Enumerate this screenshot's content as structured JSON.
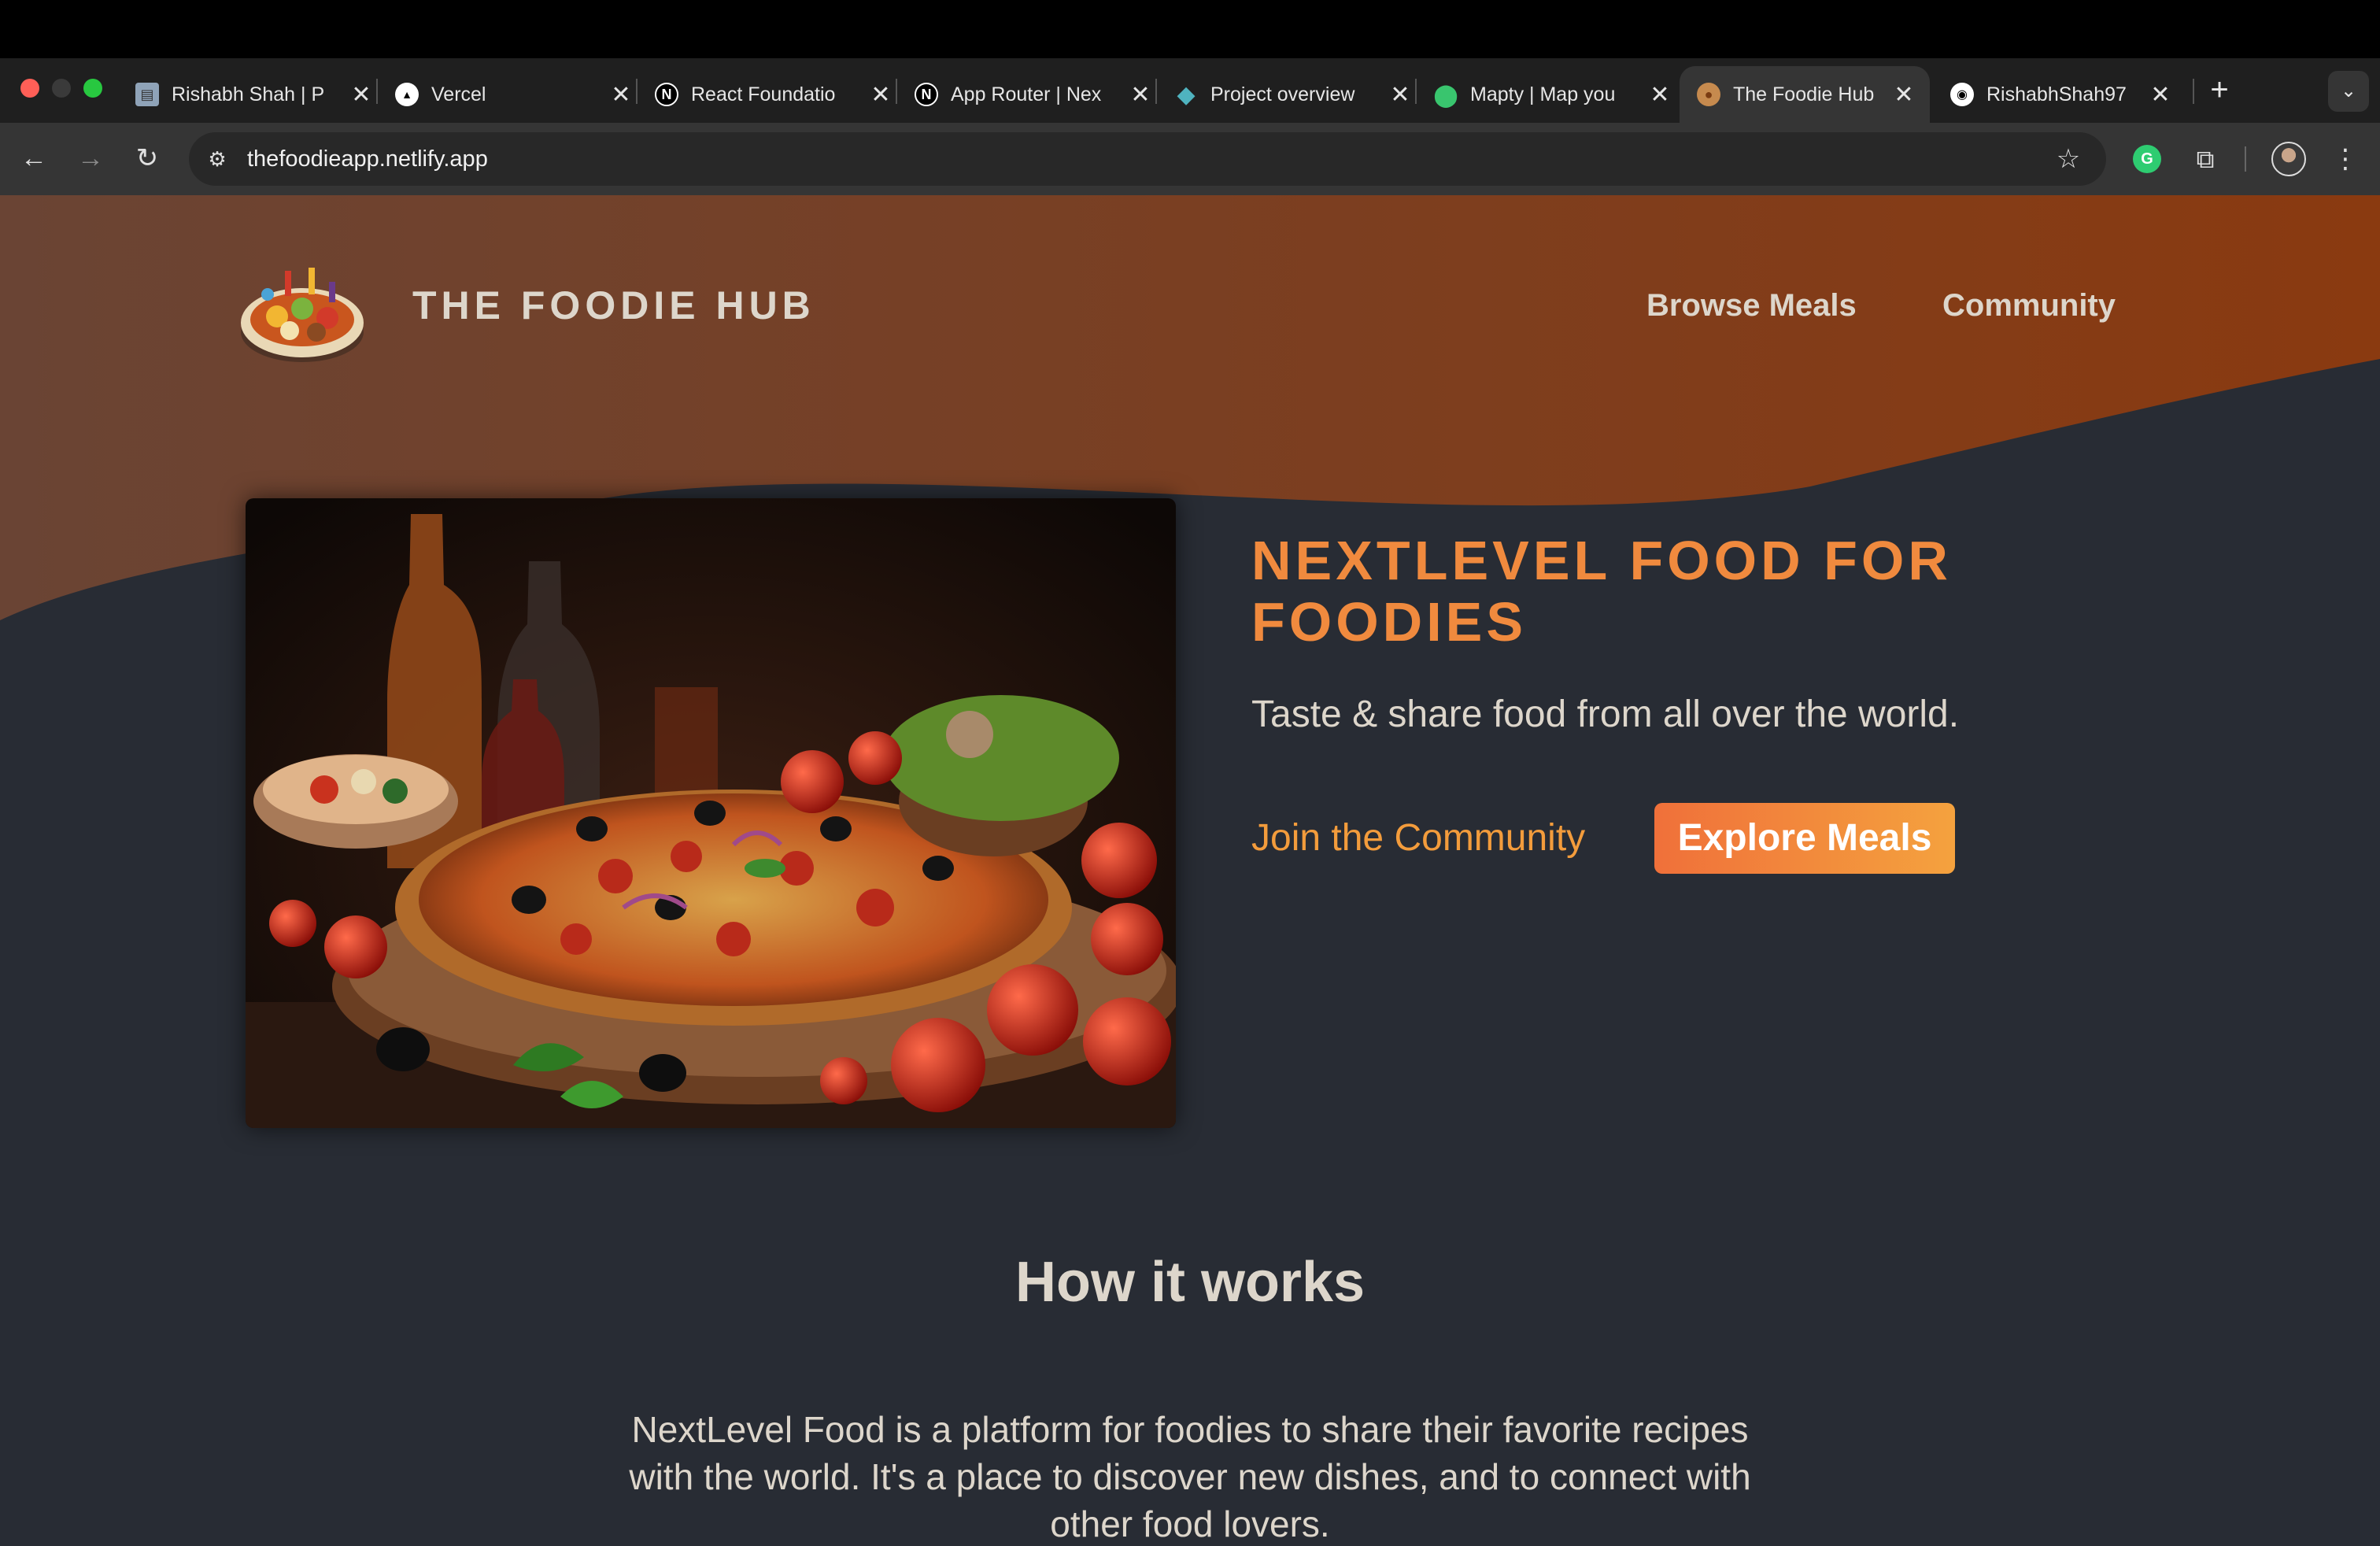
{
  "browser": {
    "tabs": [
      {
        "title": "Rishabh Shah | P",
        "icon": "portfolio-favicon"
      },
      {
        "title": "Vercel",
        "icon": "vercel-triangle-icon"
      },
      {
        "title": "React Foundatio",
        "icon": "nextjs-icon"
      },
      {
        "title": "App Router | Nex",
        "icon": "nextjs-icon"
      },
      {
        "title": "Project overview",
        "icon": "diamond-icon"
      },
      {
        "title": "Mapty | Map you",
        "icon": "map-pin-icon"
      },
      {
        "title": "The Foodie Hub",
        "icon": "food-favicon",
        "active": true
      },
      {
        "title": "RishabhShah97",
        "icon": "github-icon"
      }
    ],
    "tab_close_glyph": "✕",
    "new_tab_glyph": "+",
    "tab_menu_glyph": "⌄",
    "url": "thefoodieapp.netlify.app",
    "colors": {
      "tabstrip": "#1f1f1f",
      "toolbar": "#353535",
      "omnibox": "#282828"
    }
  },
  "site": {
    "brand": "THE FOODIE HUB",
    "nav": {
      "browse": "Browse Meals",
      "community": "Community"
    },
    "hero": {
      "title_line1": "NEXTLEVEL FOOD FOR",
      "title_line2": "FOODIES",
      "subtitle": "Taste & share food from all over the world.",
      "join_label": "Join the Community",
      "explore_label": "Explore Meals"
    },
    "how": {
      "title": "How it works",
      "line1": "NextLevel Food is a platform for foodies to share their favorite recipes",
      "line2": "with the world. It's a place to discover new dishes, and to connect with",
      "line3": "other food lovers."
    },
    "colors": {
      "background": "#282c34",
      "header_gradient_start": "#6a4434",
      "header_gradient_end": "#8a3a10",
      "accent_orange": "#f08a3e",
      "text": "#ddd6cb",
      "button_gradient_start": "#f0703a",
      "button_gradient_end": "#f4a23e"
    }
  }
}
